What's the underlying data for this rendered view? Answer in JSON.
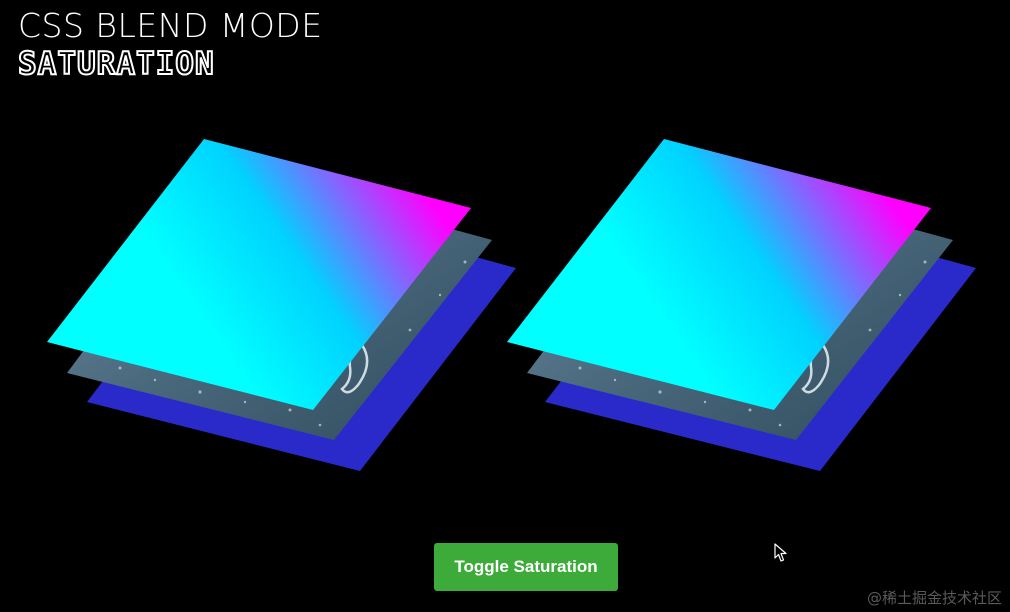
{
  "header": {
    "title": "CSS BLEND MODE",
    "subtitle": "SATURATION"
  },
  "button": {
    "label": "Toggle Saturation"
  },
  "watermark": "@稀土掘金技术社区",
  "colors": {
    "background": "#000000",
    "button": "#3dab3a",
    "gradient_start": "#00ffff",
    "gradient_mid": "#00d2ff",
    "gradient_end": "#ff00ff",
    "base_layer": "#2a2acb",
    "photo_layer": "#4d6b80"
  },
  "icons": {
    "cursor": "mouse-pointer-icon"
  }
}
